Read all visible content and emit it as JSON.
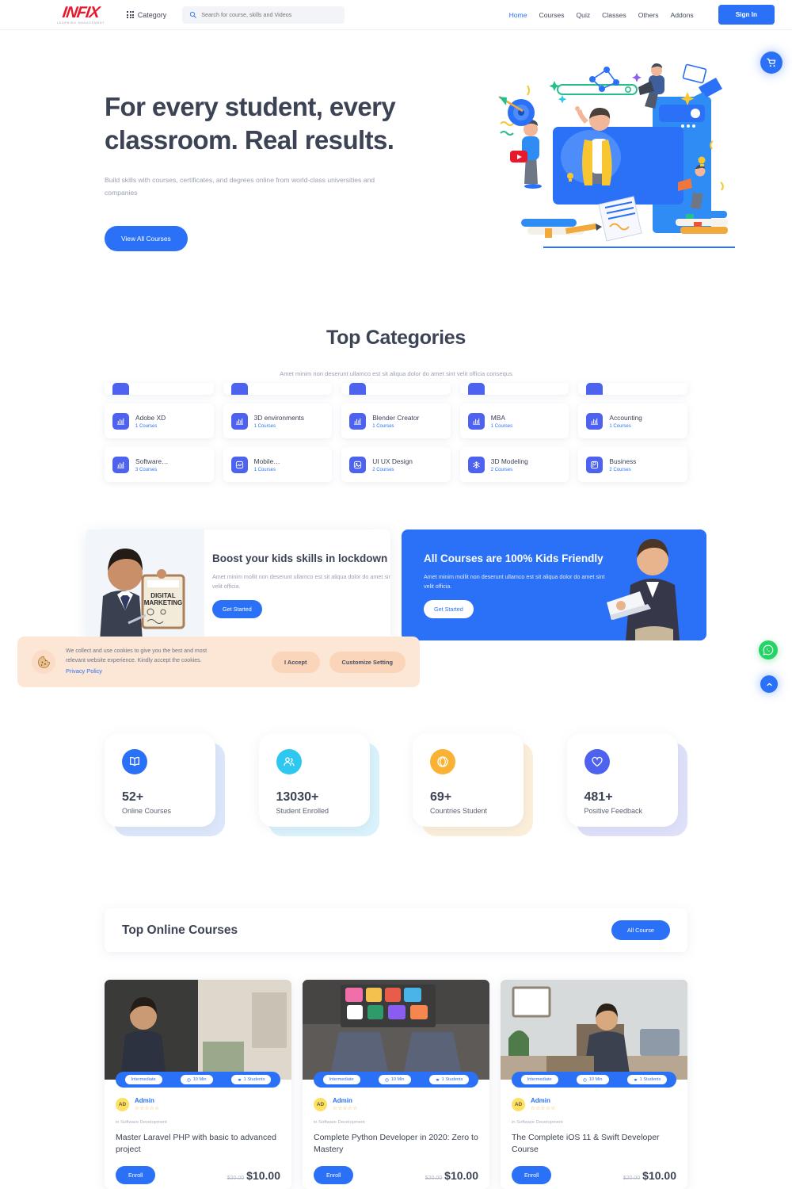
{
  "header": {
    "logo_main": "INFIX",
    "logo_sub": "LEARNING MANAGEMENT",
    "category_label": "Category",
    "search_placeholder": "Search for course, skills and Videos",
    "search_value": "",
    "nav": [
      {
        "label": "Home",
        "active": true
      },
      {
        "label": "Courses",
        "active": false
      },
      {
        "label": "Quiz",
        "active": false
      },
      {
        "label": "Classes",
        "active": false
      },
      {
        "label": "Others",
        "active": false
      },
      {
        "label": "Addons",
        "active": false
      }
    ],
    "signin_label": "Sign In"
  },
  "hero": {
    "title": "For every student, every classroom. Real results.",
    "subtitle": "Build skills with courses, certificates, and degrees online from world-class universities and companies",
    "cta_label": "View All Courses"
  },
  "categories_section": {
    "title": "Top Categories",
    "subtitle": "Amet minim non deserunt ullamco est sit aliqua dolor do amet sint velit officia consequs",
    "items": [
      {
        "name": "Adobe XD",
        "count": "1 Courses",
        "icon": "bar-chart-icon"
      },
      {
        "name": "3D environments",
        "count": "1 Courses",
        "icon": "bar-chart-icon"
      },
      {
        "name": "Blender Creator",
        "count": "1 Courses",
        "icon": "bar-chart-icon"
      },
      {
        "name": "MBA",
        "count": "1 Courses",
        "icon": "bar-chart-icon"
      },
      {
        "name": "Accounting",
        "count": "1 Courses",
        "icon": "bar-chart-icon"
      },
      {
        "name": "Software…",
        "count": "3 Courses",
        "icon": "bar-chart-icon"
      },
      {
        "name": "Mobile…",
        "count": "1 Courses",
        "icon": "image-icon"
      },
      {
        "name": "UI UX Design",
        "count": "2 Courses",
        "icon": "image-icon"
      },
      {
        "name": "3D Modeling",
        "count": "2 Courses",
        "icon": "snowflake-icon"
      },
      {
        "name": "Business",
        "count": "2 Courses",
        "icon": "palette-icon"
      }
    ]
  },
  "promos": [
    {
      "heading": "Boost your kids skills in lockdown",
      "text": "Amet minim mollit non deserunt ullamco est sit aliqua dolor do amet sint velit officia.",
      "button": "Get Started"
    },
    {
      "heading": "All Courses are 100% Kids Friendly",
      "text": "Amet minim mollit non deserunt ullamco est sit aliqua dolor do amet sint velit officia.",
      "button": "Get Started"
    }
  ],
  "cookie": {
    "text": "We collect and use cookies to give you the best and most relevant website experience. Kindly accept the cookies.",
    "link": "Privacy Policy",
    "accept_label": "I Accept",
    "customize_label": "Customize Setting"
  },
  "stats": [
    {
      "number": "52+",
      "label": "Online Courses",
      "color": "#2a71f8",
      "shadow": "#dde7fb",
      "icon": "book-icon"
    },
    {
      "number": "13030+",
      "label": "Student Enrolled",
      "color": "#2ec7f0",
      "shadow": "#daf2fb",
      "icon": "users-icon"
    },
    {
      "number": "69+",
      "label": "Countries Student",
      "color": "#f9b233",
      "shadow": "#fcefd9",
      "icon": "globe-icon"
    },
    {
      "number": "481+",
      "label": "Positive Feedback",
      "color": "#4d63f0",
      "shadow": "#dfe1fa",
      "icon": "heart-icon"
    }
  ],
  "top_courses": {
    "title": "Top Online Courses",
    "all_label": "All Course",
    "items": [
      {
        "level": "Intermediate",
        "duration": "10 Min",
        "students": "1 Students",
        "avatar_initials": "AD",
        "author": "Admin",
        "rating_stars": "☆☆☆☆☆",
        "category_prefix": "in",
        "category": "Software Development",
        "title": "Master Laravel PHP with basic to advanced project",
        "enroll_label": "Enroll",
        "price_old": "$20.00",
        "price_new": "$10.00"
      },
      {
        "level": "Intermediate",
        "duration": "10 Min",
        "students": "1 Students",
        "avatar_initials": "AD",
        "author": "Admin",
        "rating_stars": "☆☆☆☆☆",
        "category_prefix": "in",
        "category": "Software Development",
        "title": "Complete Python Developer in 2020: Zero to Mastery",
        "enroll_label": "Enroll",
        "price_old": "$20.00",
        "price_new": "$10.00"
      },
      {
        "level": "Intermediate",
        "duration": "10 Min",
        "students": "1 Students",
        "avatar_initials": "AD",
        "author": "Admin",
        "rating_stars": "☆☆☆☆☆",
        "category_prefix": "in",
        "category": "Software Development",
        "title": "The Complete iOS 11 & Swift Developer Course",
        "enroll_label": "Enroll",
        "price_old": "$20.00",
        "price_new": "$10.00"
      }
    ]
  },
  "floating": {
    "cart": "cart-icon",
    "whatsapp": "whatsapp-icon",
    "scroll_top": "chevron-up-icon"
  },
  "colors": {
    "primary": "#2a71f8",
    "indigo": "#4d63f0",
    "logo_red": "#e8192c",
    "cookie_bg": "#fce6d6",
    "whatsapp_green": "#25d366"
  }
}
